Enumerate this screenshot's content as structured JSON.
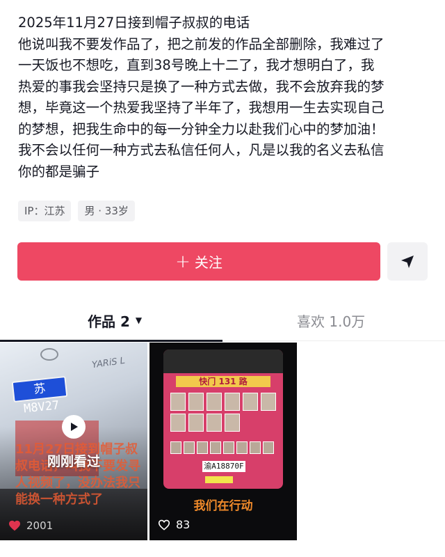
{
  "bio": {
    "lines": [
      "2025年11月27日接到帽子叔叔的电话",
      "他说叫我不要发作品了，把之前发的作品全部删除，我难过了",
      "一天饭也不想吃，直到38号晚上十二了，我才想明白了，我",
      "热爱的事我会坚持只是换了一种方式去做，我不会放弃我的梦",
      "想，毕竟这一个热爱我坚持了半年了，我想用一生去实现自己",
      "的梦想，把我生命中的每一分钟全力以赴我们心中的梦加油！",
      "我不会以任何一种方式去私信任何人，凡是以我的名义去私信",
      "你的都是骗子"
    ]
  },
  "tags": {
    "ip": "IP：江苏",
    "gender_age": "男 · 33岁"
  },
  "actions": {
    "follow_plus": "+",
    "follow_label": "关注",
    "share_icon": "send-icon"
  },
  "tabs": {
    "works_label": "作品 2",
    "likes_label": "喜欢 1.0万"
  },
  "videos": [
    {
      "plate": "苏 M8V27",
      "car_model": "YARiS L",
      "overlay_text": "11月27日接到帽子叔叔电话，叫我不要发寻人视频了，没办法我只能换一种方式了",
      "status": "刚刚看过",
      "likes": "2001"
    },
    {
      "bus_sign": "快门 131 路",
      "plate": "渝A18870F",
      "caption": "我们在行动",
      "likes": "83"
    }
  ],
  "colors": {
    "accent": "#ee4863",
    "text": "#161823",
    "muted": "#8a8b91",
    "tag_bg": "#f2f2f4"
  }
}
